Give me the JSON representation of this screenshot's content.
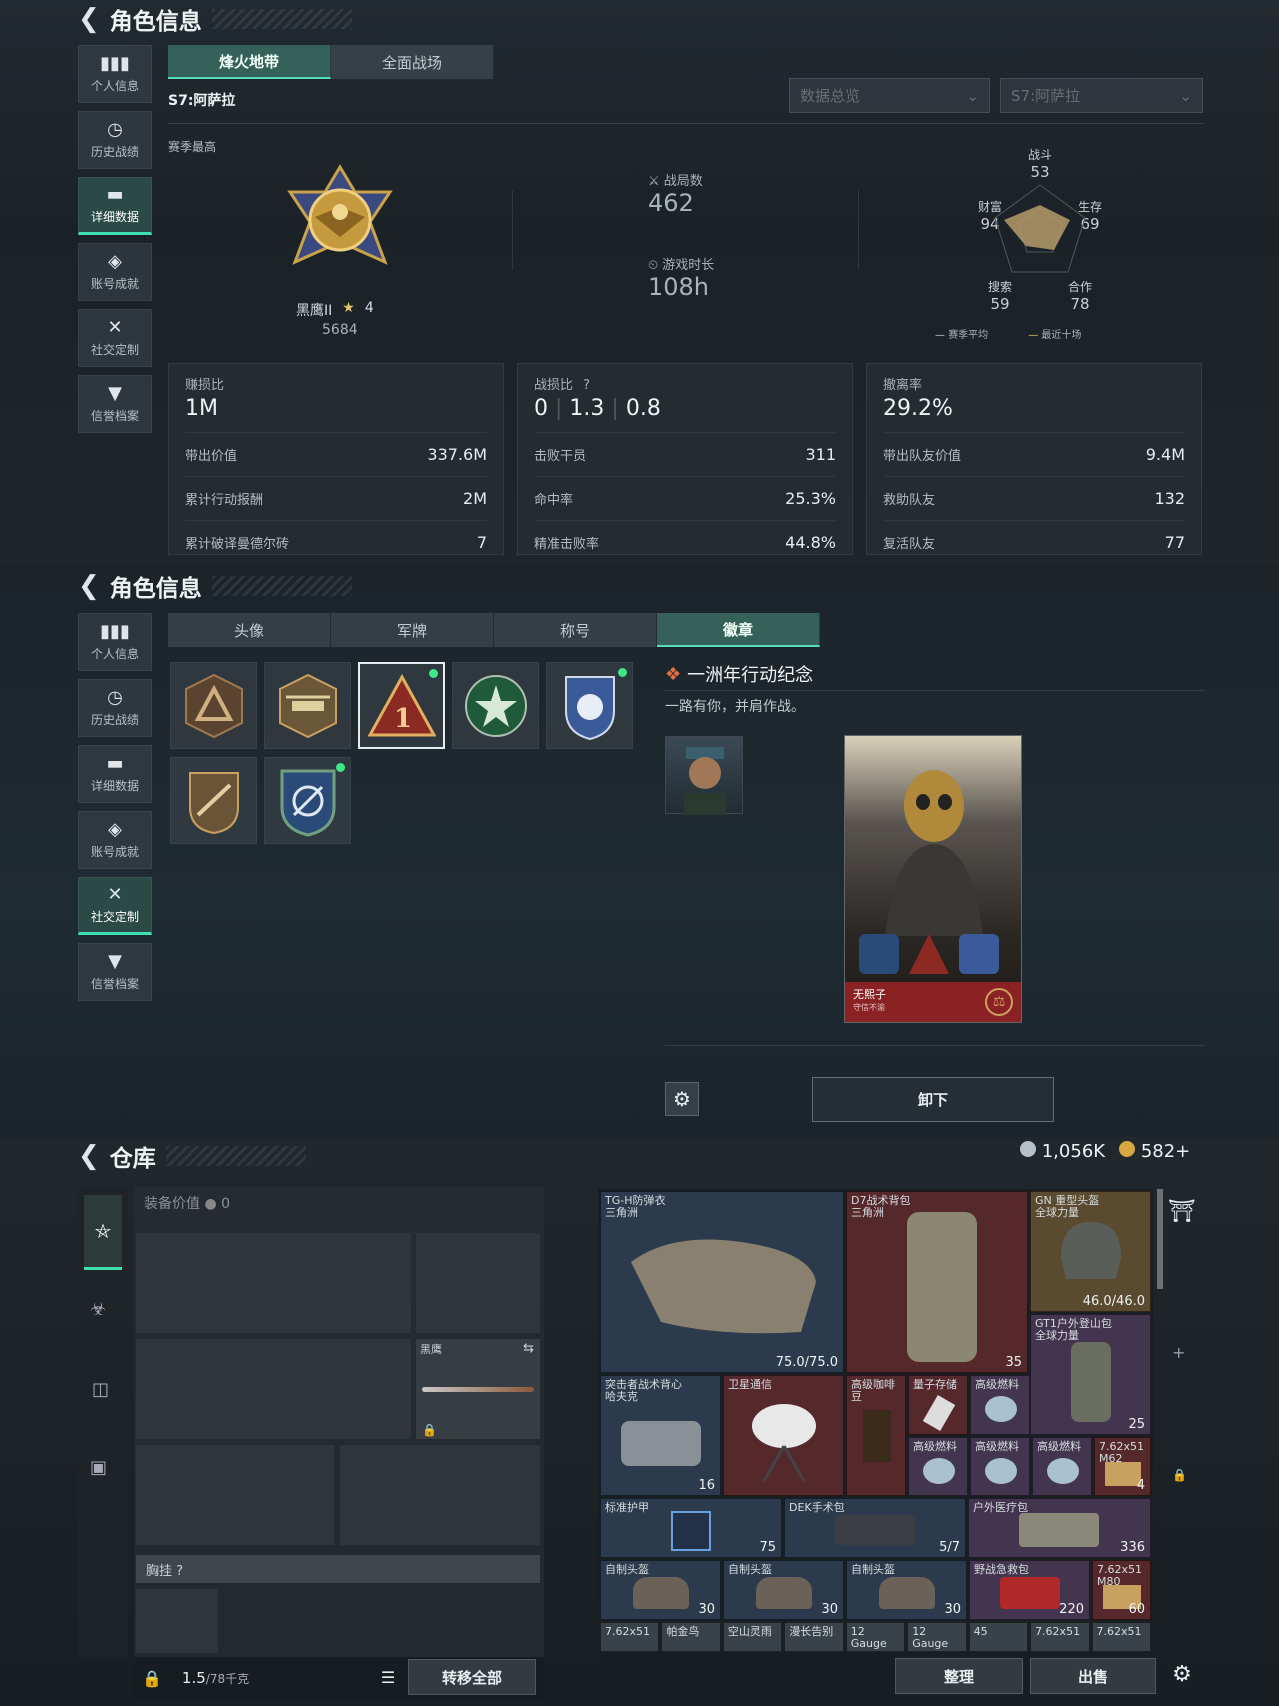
{
  "p1": {
    "title": "角色信息",
    "nav": [
      {
        "icon": "▮▮▮",
        "label": "个人信息"
      },
      {
        "icon": "◷",
        "label": "历史战绩"
      },
      {
        "icon": "▬",
        "label": "详细数据"
      },
      {
        "icon": "◈",
        "label": "账号成就"
      },
      {
        "icon": "✕",
        "label": "社交定制"
      },
      {
        "icon": "▼",
        "label": "信誉档案"
      }
    ],
    "tabs": [
      "烽火地带",
      "全面战场"
    ],
    "season": "S7:阿萨拉",
    "dropdown1": "数据总览",
    "dropdown2": "S7:阿萨拉",
    "season_best": "赛季最高",
    "rank_name": "黑鹰II",
    "rank_stars": "4",
    "rank_score": "5684",
    "battles_label": "战局数",
    "battles": "462",
    "time_label": "游戏时长",
    "time": "108h",
    "radar": {
      "combat_label": "战斗",
      "combat": 53,
      "survive_label": "生存",
      "survive": 69,
      "coop_label": "合作",
      "coop": 78,
      "search_label": "搜索",
      "search": 59,
      "wealth_label": "财富",
      "wealth": 94,
      "legend1": "赛季平均",
      "legend2": "最近十场"
    },
    "card1": {
      "top": "赚损比",
      "main": "1M",
      "rows": [
        [
          "带出价值",
          "337.6M"
        ],
        [
          "累计行动报酬",
          "2M"
        ],
        [
          "累计破译曼德尔砖",
          "7"
        ]
      ]
    },
    "card2": {
      "top": "战损比",
      "main_a": "0",
      "main_b": "1.3",
      "main_c": "0.8",
      "rows": [
        [
          "击败干员",
          "311"
        ],
        [
          "命中率",
          "25.3%"
        ],
        [
          "精准击败率",
          "44.8%"
        ]
      ]
    },
    "card3": {
      "top": "撤离率",
      "main": "29.2%",
      "rows": [
        [
          "带出队友价值",
          "9.4M"
        ],
        [
          "救助队友",
          "132"
        ],
        [
          "复活队友",
          "77"
        ]
      ]
    }
  },
  "p2": {
    "title": "角色信息",
    "tabs": [
      "头像",
      "军牌",
      "称号",
      "徽章"
    ],
    "badge_title": "一洲年行动纪念",
    "badge_desc": "一路有你，并肩作战。",
    "card_name": "无熙子",
    "card_sub": "守信不渝",
    "unequip": "卸下"
  },
  "p3": {
    "title": "仓库",
    "currency1": "1,056K",
    "currency2": "582",
    "equip_value_label": "装备价值",
    "equip_value": "0",
    "knife_label": "黑鹰",
    "chest_label": "胸挂",
    "weight": "1.5",
    "weight_unit": "/78千克",
    "transfer_all": "转移全部",
    "sort": "整理",
    "sell": "出售",
    "items": [
      {
        "name": "TG-H防弹衣\n三角洲",
        "count": "75.0/75.0"
      },
      {
        "name": "D7战术背包\n三角洲",
        "count": "35"
      },
      {
        "name": "GN 重型头盔\n全球力量",
        "count": "46.0/46.0"
      },
      {
        "name": "GT1户外登山包\n全球力量",
        "count": "25"
      },
      {
        "name": "突击者战术背心\n哈夫克",
        "count": "16"
      },
      {
        "name": "卫星通信",
        "count": ""
      },
      {
        "name": "高级咖啡豆",
        "count": ""
      },
      {
        "name": "量子存储",
        "count": ""
      },
      {
        "name": "高级燃料",
        "count": ""
      },
      {
        "name": "高级燃料",
        "count": ""
      },
      {
        "name": "高级燃料",
        "count": ""
      },
      {
        "name": "高级燃料",
        "count": ""
      },
      {
        "name": "7.62x51\nM62",
        "count": "4"
      },
      {
        "name": "标准护甲",
        "count": "75"
      },
      {
        "name": "DEK手术包",
        "count": "5/7"
      },
      {
        "name": "户外医疗包",
        "count": "336"
      },
      {
        "name": "自制头盔",
        "count": "30"
      },
      {
        "name": "自制头盔",
        "count": "30"
      },
      {
        "name": "自制头盔",
        "count": "30"
      },
      {
        "name": "野战急救包",
        "count": "220"
      },
      {
        "name": "7.62x51\nM80",
        "count": "60"
      }
    ],
    "bottom_row": [
      "7.62x51",
      "帕金鸟",
      "空山灵雨",
      "漫长告别",
      "12 Gauge",
      "12 Gauge",
      "45",
      "7.62x51",
      "7.62x51"
    ]
  }
}
